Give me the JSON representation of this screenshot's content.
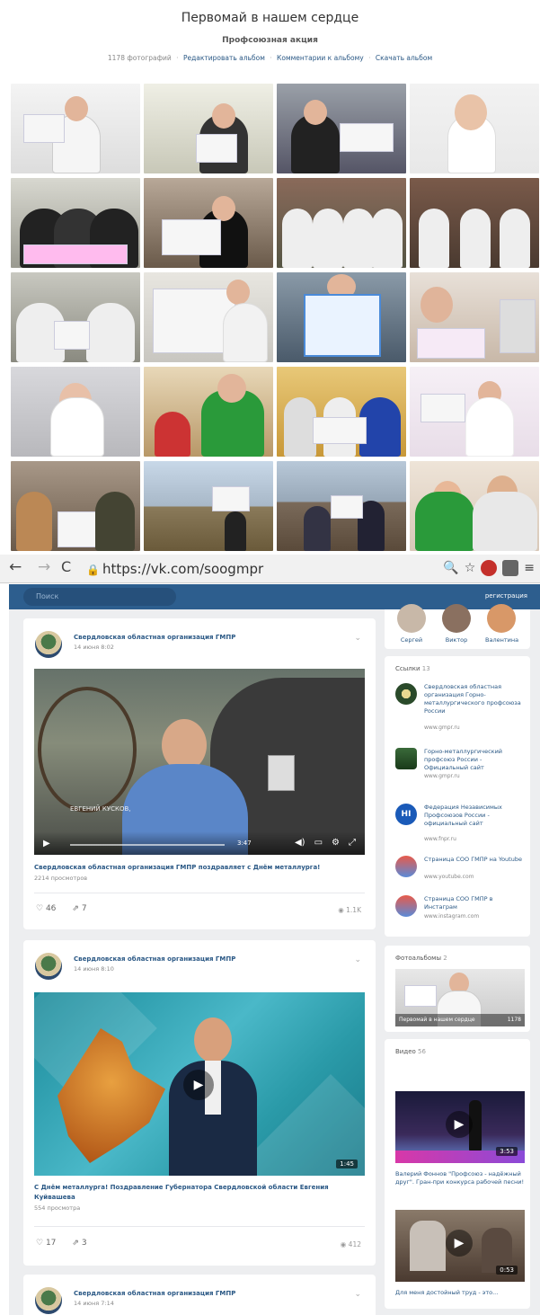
{
  "album": {
    "title": "Первомай в нашем сердце",
    "subtitle": "Профсоюзная акция",
    "count": "1178 фотографий",
    "links": [
      "Редактировать альбом",
      "Комментарии к альбому",
      "Скачать альбом"
    ]
  },
  "browser": {
    "url": "https://vk.com/soogmpr",
    "back_icon": "arrow-left-icon",
    "forward_icon": "arrow-right-icon",
    "reload_icon": "reload-icon"
  },
  "vk": {
    "search_placeholder": "Поиск",
    "register_label": "регистрация"
  },
  "posts": [
    {
      "author": "Свердловская областная организация ГМПР",
      "date": "14 июня 8:02",
      "caption": "Свердловская областная организация ГМПР поздравляет с Днём металлурга!",
      "views_text": "2214 просмотров",
      "video_time": "3:47",
      "overlay_name": "ЕВГЕНИЙ КУСКОВ,",
      "likes": "46",
      "shares": "7",
      "views": "1.1K"
    },
    {
      "author": "Свердловская областная организация ГМПР",
      "date": "14 июня 8:10",
      "caption": "С Днём металлурга! Поздравление Губернатора Свердловской области Евгения Куйвашева",
      "views_text": "554 просмотра",
      "duration": "1:45",
      "likes": "17",
      "shares": "3",
      "views": "412"
    },
    {
      "author": "Свердловская областная организация ГМПР",
      "date": "14 июня 7:14"
    }
  ],
  "sidebar": {
    "friends": [
      "Сергей",
      "Виктор",
      "Валентина"
    ],
    "links_title": "Ссылки",
    "links_count": "13",
    "links": [
      {
        "name": "Свердловская областная организация Горно-металлургического профсоюза России",
        "url": "www.gmpr.ru"
      },
      {
        "name": "Горно-металлургический профсоюз России - Официальный сайт",
        "url": "www.gmpr.ru"
      },
      {
        "name": "Федерация Независимых Профсоюзов России - официальный сайт",
        "url": "www.fnpr.ru"
      },
      {
        "name": "Страница СОО ГМПР на Youtube",
        "url": "www.youtube.com"
      },
      {
        "name": "Страница СОО ГМПР в Инстаграм",
        "url": "www.instagram.com"
      }
    ],
    "albums_title": "Фотоальбомы",
    "albums_count": "2",
    "album_name": "Первомай в нашем сердце",
    "album_count": "1178",
    "videos_title": "Видео",
    "videos_count": "56",
    "videos": [
      {
        "title": "Валерий Фоннов \"Профсоюз - надёжный друг\". Гран-при конкурса рабочей песни!",
        "duration": "3:53"
      },
      {
        "title": "Для меня достойный труд - это...",
        "duration": "0:53"
      }
    ]
  },
  "colors": {
    "vk_blue": "#2d5e8e",
    "link": "#2a5885",
    "page_bg": "#edeef0"
  }
}
